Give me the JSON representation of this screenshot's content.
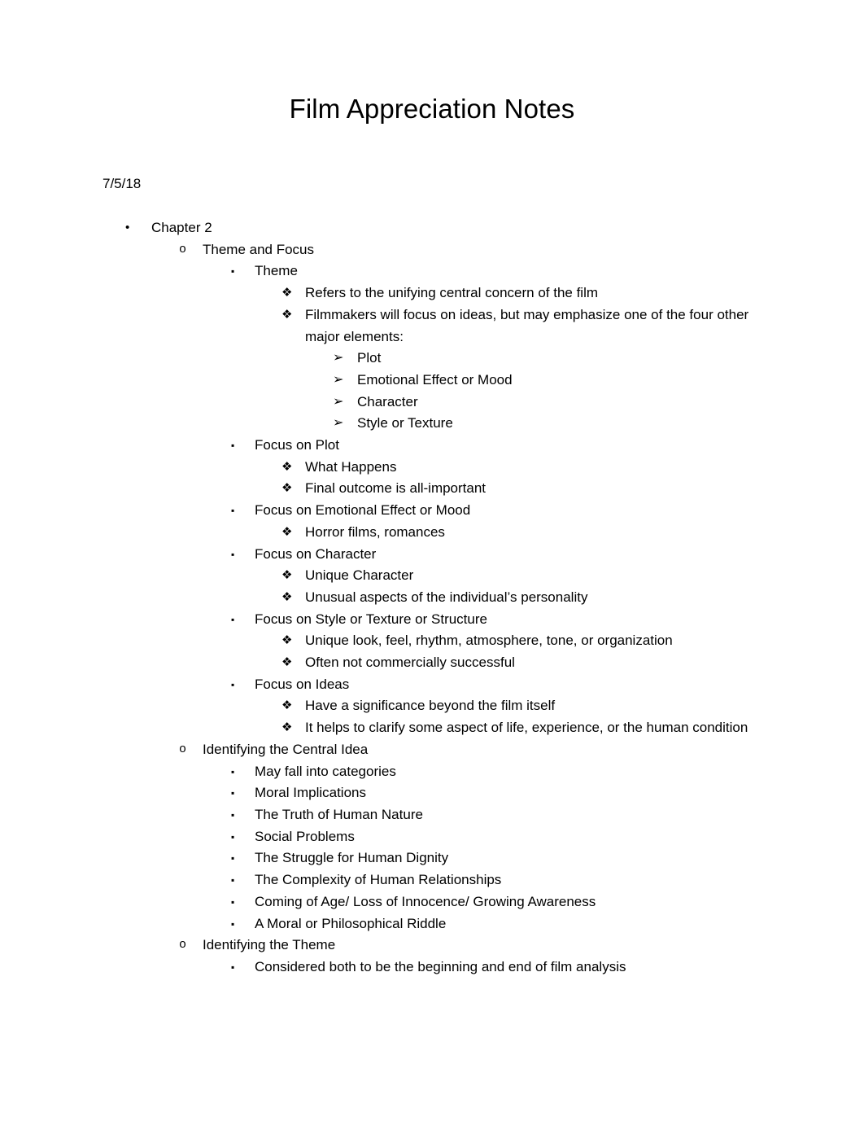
{
  "document": {
    "title": "Film Appreciation Notes",
    "date": "7/5/18",
    "page_background": "#ffffff",
    "text_color": "#000000"
  },
  "markers": {
    "level1": "•",
    "level2": "o",
    "level3": "▪",
    "level4": "❖",
    "level5": "➢"
  },
  "marker_names": {
    "level1": "disc-bullet-icon",
    "level2": "circle-letter-bullet-icon",
    "level3": "square-bullet-icon",
    "level4": "diamond-bullet-icon",
    "level5": "arrowhead-bullet-icon"
  },
  "outline": [
    {
      "level": 1,
      "text": "Chapter 2"
    },
    {
      "level": 2,
      "text": "Theme and Focus"
    },
    {
      "level": 3,
      "text": "Theme"
    },
    {
      "level": 4,
      "text": "Refers to the unifying central concern of the film"
    },
    {
      "level": 4,
      "text": "Filmmakers will focus on ideas, but may emphasize one of the four other major elements:"
    },
    {
      "level": 5,
      "text": "Plot"
    },
    {
      "level": 5,
      "text": "Emotional Effect or Mood"
    },
    {
      "level": 5,
      "text": "Character"
    },
    {
      "level": 5,
      "text": "Style or Texture"
    },
    {
      "level": 3,
      "text": "Focus on Plot"
    },
    {
      "level": 4,
      "text": "What Happens"
    },
    {
      "level": 4,
      "text": "Final outcome is all-important"
    },
    {
      "level": 3,
      "text": "Focus on Emotional Effect or Mood"
    },
    {
      "level": 4,
      "text": "Horror films, romances"
    },
    {
      "level": 3,
      "text": "Focus on Character"
    },
    {
      "level": 4,
      "text": "Unique Character"
    },
    {
      "level": 4,
      "text": "Unusual aspects of the individual’s personality"
    },
    {
      "level": 3,
      "text": "Focus on Style or Texture or Structure"
    },
    {
      "level": 4,
      "text": "Unique look, feel, rhythm, atmosphere, tone, or organization"
    },
    {
      "level": 4,
      "text": "Often not commercially successful"
    },
    {
      "level": 3,
      "text": "Focus on Ideas"
    },
    {
      "level": 4,
      "text": "Have a significance beyond the film itself"
    },
    {
      "level": 4,
      "text": "It helps to clarify some aspect of life, experience, or the human condition"
    },
    {
      "level": 2,
      "text": "Identifying the Central Idea"
    },
    {
      "level": 3,
      "text": "May fall into categories"
    },
    {
      "level": 3,
      "text": "Moral Implications"
    },
    {
      "level": 3,
      "text": "The Truth of Human Nature"
    },
    {
      "level": 3,
      "text": "Social Problems"
    },
    {
      "level": 3,
      "text": "The Struggle for Human Dignity"
    },
    {
      "level": 3,
      "text": "The Complexity of Human Relationships"
    },
    {
      "level": 3,
      "text": "Coming of Age/ Loss of Innocence/ Growing Awareness"
    },
    {
      "level": 3,
      "text": "A Moral or Philosophical Riddle"
    },
    {
      "level": 2,
      "text": "Identifying the Theme"
    },
    {
      "level": 3,
      "text": "Considered both to be the beginning and end of film analysis"
    }
  ]
}
